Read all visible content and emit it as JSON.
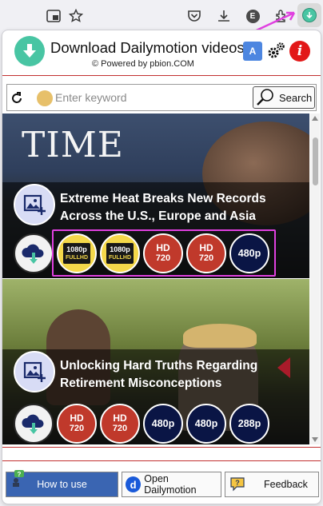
{
  "browser": {
    "toolbar_icons": [
      "picture-in-picture-icon",
      "bookmark-star-icon",
      "pocket-icon",
      "download-icon",
      "account-icon",
      "extensions-icon",
      "dailymotion-downloader-extension-icon"
    ],
    "account_initial": "E"
  },
  "header": {
    "title": "Download Dailymotion videos",
    "subtitle": "© Powered by pbion.COM",
    "translate_label": "A"
  },
  "search": {
    "placeholder": "Enter keyword",
    "value": "",
    "button_label": "Search"
  },
  "videos": [
    {
      "title": "Extreme Heat Breaks New Records Across the U.S., Europe and Asia",
      "thumbnail_text": "TIME",
      "downloads": [
        {
          "type": "cloud"
        },
        {
          "type": "fhd",
          "top": "1080p",
          "bottom": "FULLHD"
        },
        {
          "type": "fhd",
          "top": "1080p",
          "bottom": "FULLHD"
        },
        {
          "type": "hd",
          "top": "HD",
          "bottom": "720"
        },
        {
          "type": "hd",
          "top": "HD",
          "bottom": "720"
        },
        {
          "type": "p",
          "label": "480p"
        }
      ]
    },
    {
      "title": "Unlocking Hard Truths Regarding Retirement Misconceptions",
      "downloads": [
        {
          "type": "cloud"
        },
        {
          "type": "hd",
          "top": "HD",
          "bottom": "720"
        },
        {
          "type": "hd",
          "top": "HD",
          "bottom": "720"
        },
        {
          "type": "p",
          "label": "480p"
        },
        {
          "type": "p",
          "label": "480p"
        },
        {
          "type": "p",
          "label": "288p"
        }
      ]
    }
  ],
  "separator_mark": "—V",
  "footer": {
    "how_to_use": "How to use",
    "open_dailymotion": "Open Dailymotion",
    "feedback": "Feedback"
  },
  "colors": {
    "accent": "#48c5a3",
    "highlight": "#e040e0",
    "hd_red": "#c0392b",
    "quality_navy": "#0a1545",
    "fhd_yellow": "#f4d84a",
    "how_to_blue": "#3a65b2"
  }
}
